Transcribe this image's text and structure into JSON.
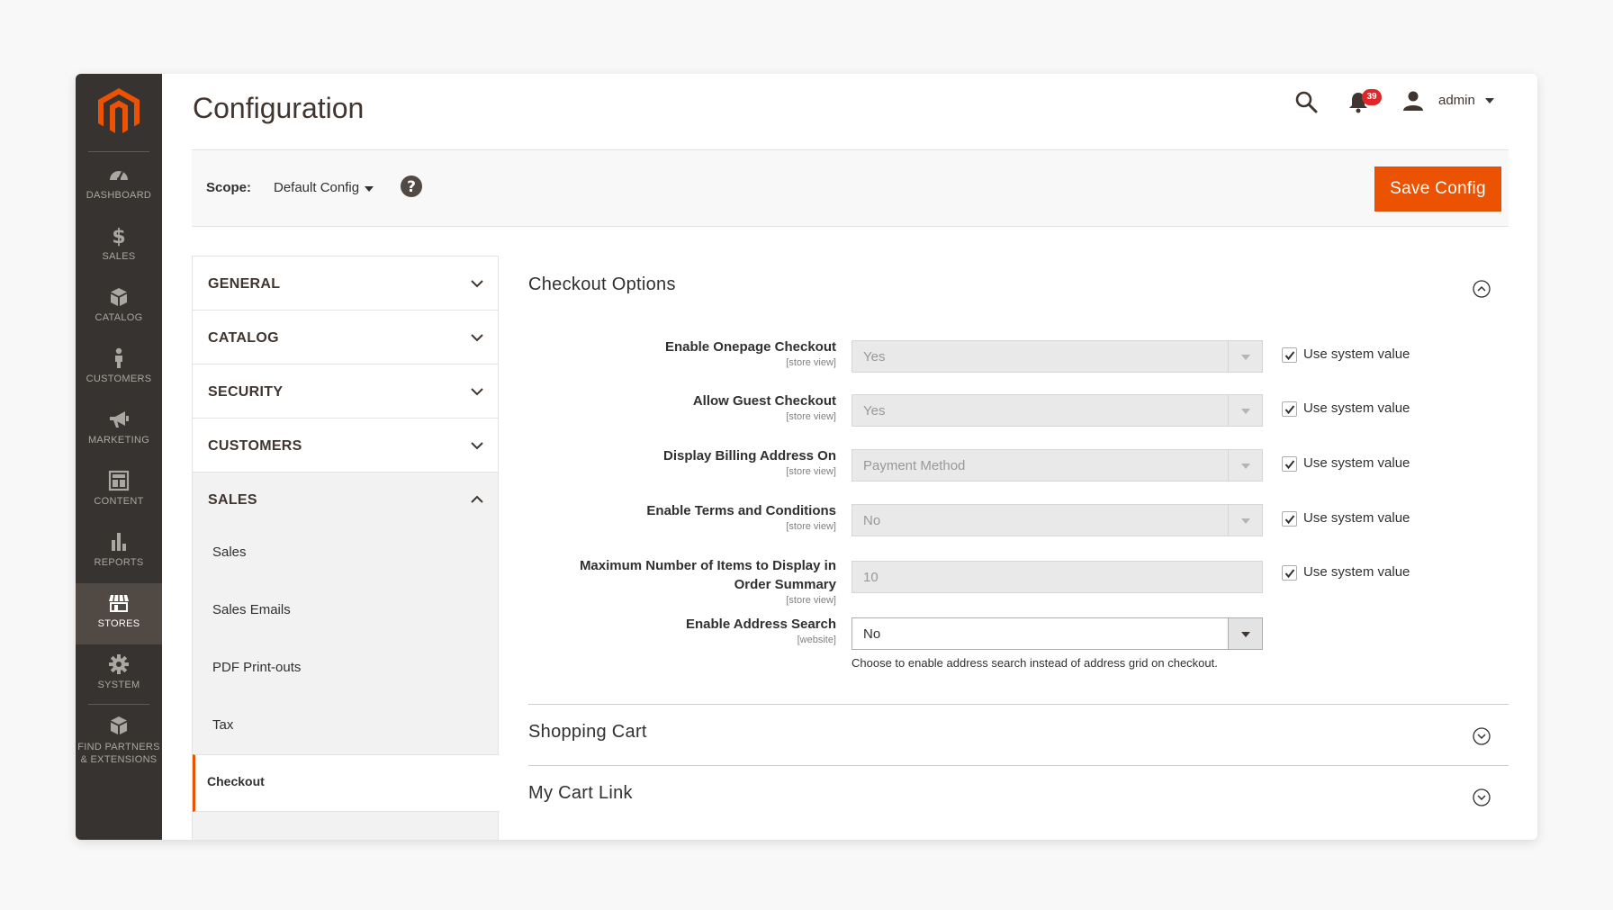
{
  "menu": {
    "items": [
      {
        "label": "DASHBOARD",
        "icon": "dashboard-icon"
      },
      {
        "label": "SALES",
        "icon": "dollar-icon"
      },
      {
        "label": "CATALOG",
        "icon": "box-icon"
      },
      {
        "label": "CUSTOMERS",
        "icon": "person-icon"
      },
      {
        "label": "MARKETING",
        "icon": "megaphone-icon"
      },
      {
        "label": "CONTENT",
        "icon": "layout-icon"
      },
      {
        "label": "REPORTS",
        "icon": "bar-chart-icon"
      },
      {
        "label": "STORES",
        "icon": "storefront-icon"
      },
      {
        "label": "SYSTEM",
        "icon": "gear-icon"
      }
    ],
    "partners_line1": "FIND PARTNERS",
    "partners_line2": "& EXTENSIONS"
  },
  "header": {
    "title": "Configuration",
    "notification_count": "39",
    "user": "admin"
  },
  "scope": {
    "label": "Scope:",
    "value": "Default Config",
    "save_label": "Save Config"
  },
  "tabs": [
    {
      "label": "GENERAL"
    },
    {
      "label": "CATALOG"
    },
    {
      "label": "SECURITY"
    },
    {
      "label": "CUSTOMERS"
    },
    {
      "label": "SALES"
    }
  ],
  "sales_items": [
    "Sales",
    "Sales Emails",
    "PDF Print-outs",
    "Tax",
    "Checkout"
  ],
  "sections": {
    "checkout_options": "Checkout Options",
    "shopping_cart": "Shopping Cart",
    "my_cart_link": "My Cart Link"
  },
  "fields": [
    {
      "label": "Enable Onepage Checkout",
      "scope": "[store view]",
      "value": "Yes",
      "system": "Use system value"
    },
    {
      "label": "Allow Guest Checkout",
      "scope": "[store view]",
      "value": "Yes",
      "system": "Use system value"
    },
    {
      "label": "Display Billing Address On",
      "scope": "[store view]",
      "value": "Payment Method",
      "system": "Use system value"
    },
    {
      "label": "Enable Terms and Conditions",
      "scope": "[store view]",
      "value": "No",
      "system": "Use system value"
    },
    {
      "label_line1": "Maximum Number of Items to Display in",
      "label_line2": "Order Summary",
      "scope": "[store view]",
      "value": "10",
      "system": "Use system value"
    },
    {
      "label": "Enable Address Search",
      "scope": "[website]",
      "value": "No",
      "note": "Choose to enable address search instead of address grid on checkout."
    }
  ],
  "colors": {
    "accent": "#eb5202",
    "menu_bg": "#373330"
  }
}
